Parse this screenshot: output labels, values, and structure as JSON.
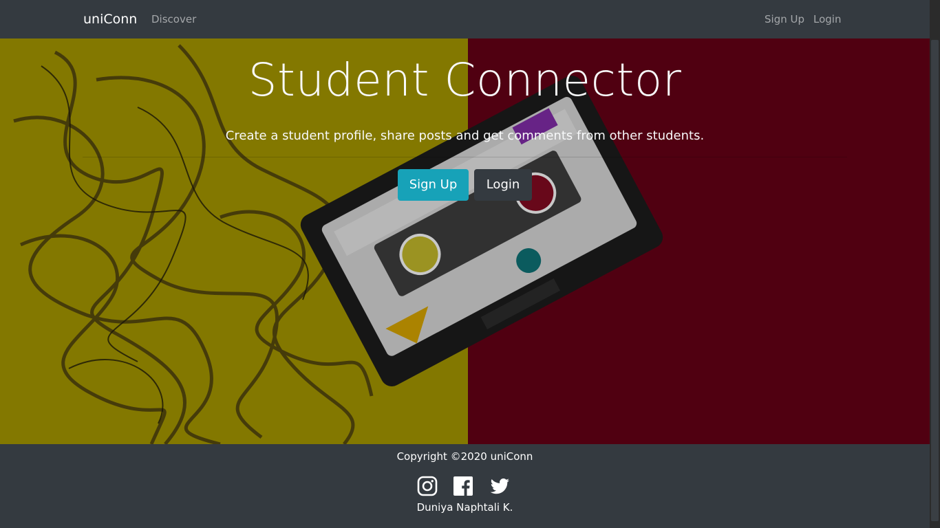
{
  "navbar": {
    "brand": "uniConn",
    "links": {
      "discover": "Discover",
      "signup": "Sign Up",
      "login": "Login"
    }
  },
  "hero": {
    "title": "Student Connector",
    "lead": "Create a student profile, share posts and get comments from other students.",
    "buttons": {
      "signup": "Sign Up",
      "login": "Login"
    },
    "background_colors": {
      "left": "#b5a300",
      "right": "#7a0218"
    }
  },
  "footer": {
    "copyright": "Copyright ©2020 uniConn",
    "social_icons": [
      "instagram-icon",
      "facebook-icon",
      "twitter-icon"
    ],
    "author": "Duniya Naphtali K."
  },
  "colors": {
    "navbar_bg": "#343a40",
    "primary_button": "#17a2b8",
    "dark_button": "#343a40"
  }
}
